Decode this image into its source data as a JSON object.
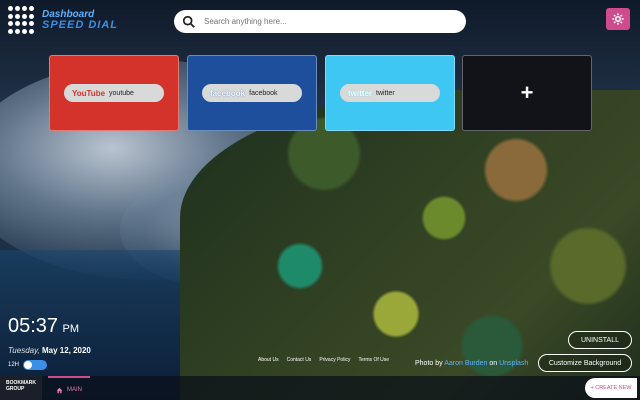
{
  "logo": {
    "line1": "Dashboard",
    "line2": "SPEED DIAL"
  },
  "search": {
    "placeholder": "Search anything here..."
  },
  "tiles": [
    {
      "label": "youtube",
      "logo": "YouTube",
      "color": "#d4332b"
    },
    {
      "label": "facebook",
      "logo": "facebook",
      "color": "#1e4f9c"
    },
    {
      "label": "twitter",
      "logo": "twitter",
      "color": "#3ec7f3"
    },
    {
      "label": "+",
      "color": "#111318"
    }
  ],
  "clock": {
    "time": "05:37",
    "ampm": "PM"
  },
  "date": {
    "weekday": "Tuesday,",
    "date": "May 12, 2020"
  },
  "toggle": {
    "label": "12H"
  },
  "footer_links": [
    "About Us",
    "Contact Us",
    "Privacy Policy",
    "Terms Of Use"
  ],
  "credit": {
    "prefix": "Photo by",
    "author": "Aaron Burden",
    "mid": "on",
    "site": "Unsplash"
  },
  "buttons": {
    "uninstall": "UNINSTALL",
    "customize": "Customize Background",
    "create": "+ CREATE NEW"
  },
  "bottom": {
    "group_line1": "BOOKMARK",
    "group_line2": "GROUP",
    "tab_main": "MAIN"
  },
  "colors": {
    "accent": "#d04b8e",
    "brand_blue": "#3a8fe8"
  }
}
